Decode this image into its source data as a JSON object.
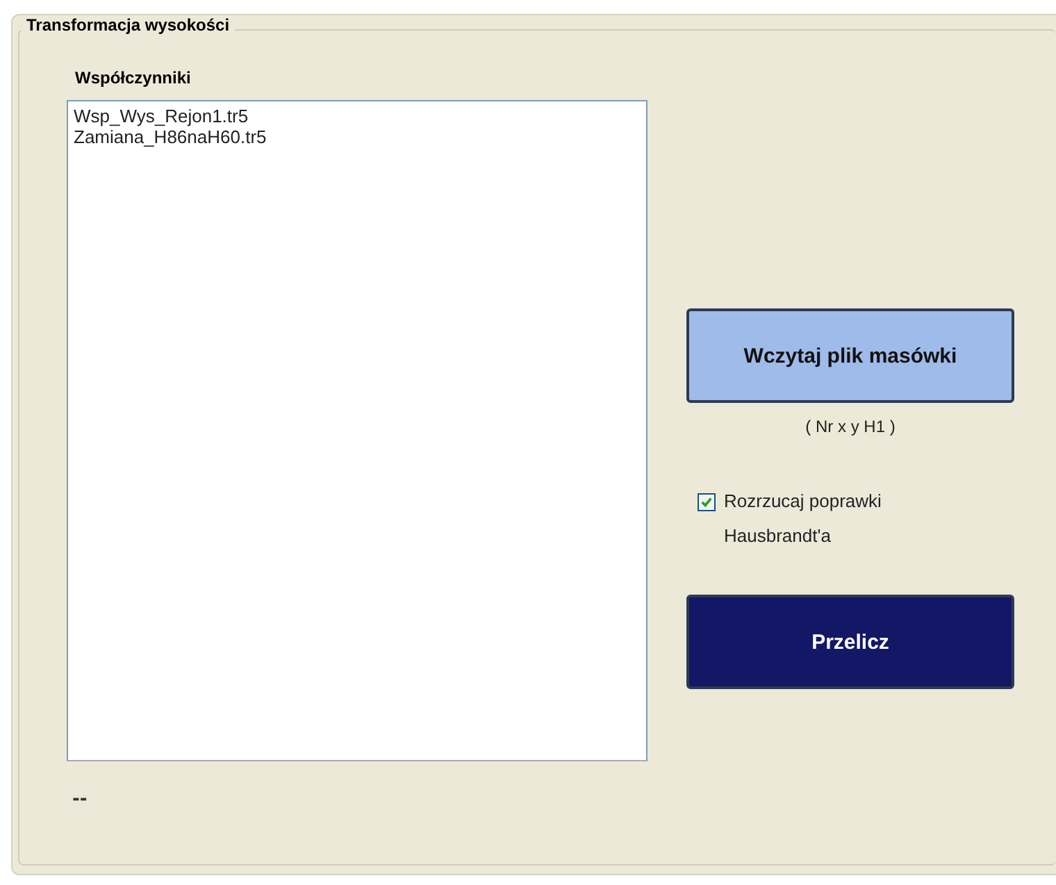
{
  "group": {
    "title": "Transformacja wysokości"
  },
  "coefficients": {
    "label": "Współczynniki",
    "items": [
      {
        "text": "Wsp_Wys_Rejon1.tr5",
        "selected": false
      },
      {
        "text": "Zamiana_H86naH60.tr5",
        "selected": false
      }
    ]
  },
  "load_button": {
    "label": "Wczytaj plik masówki"
  },
  "format_hint": "( Nr x y H1 )",
  "hausbrandt": {
    "label": "Rozrzucaj poprawki Hausbrandt'a",
    "checked": true
  },
  "compute_button": {
    "label": "Przelicz"
  },
  "status": "--"
}
